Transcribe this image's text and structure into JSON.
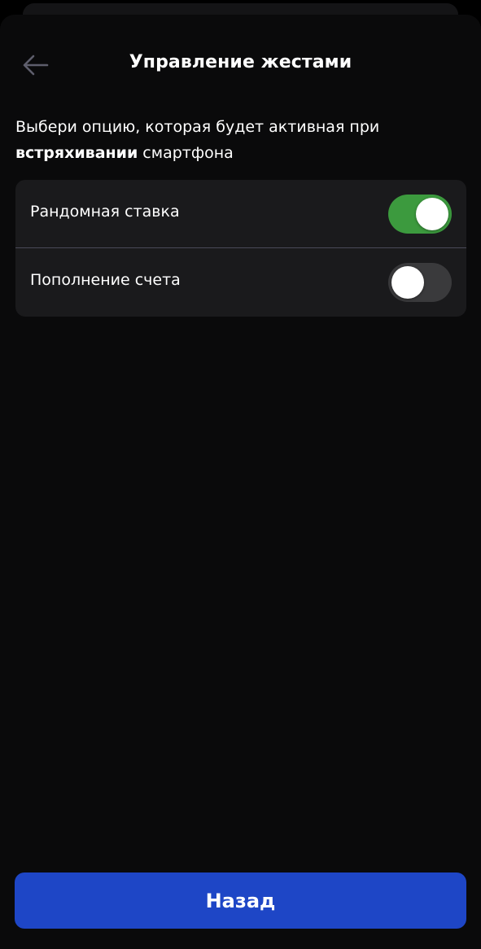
{
  "header": {
    "title": "Управление жестами",
    "back_icon": "arrow-left-icon"
  },
  "description": {
    "part1": "Выбери опцию, которая будет активная при ",
    "bold": "встряхивании",
    "part2": " смартфона"
  },
  "options": [
    {
      "label": "Рандомная ставка",
      "enabled": true
    },
    {
      "label": "Пополнение счета",
      "enabled": false
    }
  ],
  "footer": {
    "button_label": "Назад"
  },
  "colors": {
    "background": "#0a0a0b",
    "card": "#1a1a1c",
    "toggle_on": "#3c9a3e",
    "toggle_off": "#3a3a3c",
    "primary_button": "#1e46c6",
    "back_icon": "#5e5e6c"
  }
}
